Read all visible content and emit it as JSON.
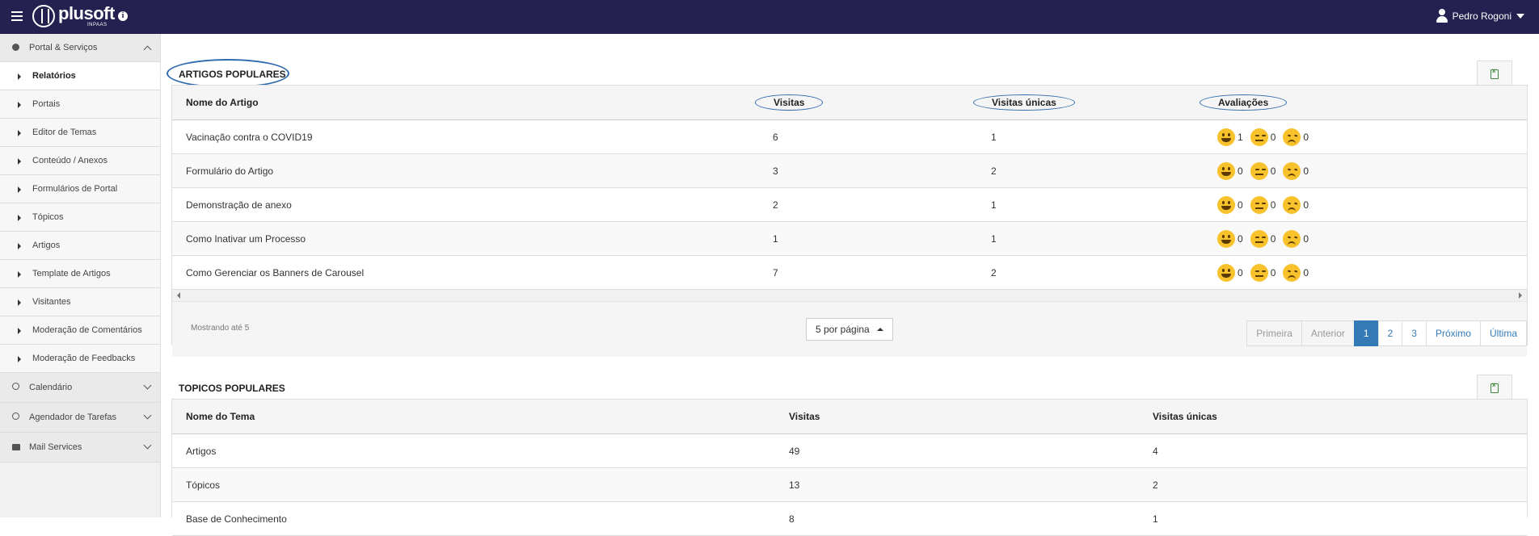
{
  "header": {
    "logo_text": "plusoft",
    "logo_sub": "INPAAS",
    "user_name": "Pedro Rogoni"
  },
  "sidebar": {
    "groups": [
      {
        "label": "Portal & Serviços",
        "icon": "globe-icon"
      },
      {
        "label": "Calendário",
        "icon": "clock-icon"
      },
      {
        "label": "Agendador de Tarefas",
        "icon": "clock-icon"
      },
      {
        "label": "Mail Services",
        "icon": "envelope-icon"
      }
    ],
    "items": [
      {
        "label": "Relatórios"
      },
      {
        "label": "Portais"
      },
      {
        "label": "Editor de Temas"
      },
      {
        "label": "Conteúdo / Anexos"
      },
      {
        "label": "Formulários de Portal"
      },
      {
        "label": "Tópicos"
      },
      {
        "label": "Artigos"
      },
      {
        "label": "Template de Artigos"
      },
      {
        "label": "Visitantes"
      },
      {
        "label": "Moderação de Comentários"
      },
      {
        "label": "Moderação de Feedbacks"
      }
    ]
  },
  "articles": {
    "title": "ARTIGOS POPULARES",
    "columns": [
      "Nome do Artigo",
      "Visitas",
      "Visitas únicas",
      "Avaliações"
    ],
    "rows": [
      {
        "name": "Vacinação contra o COVID19",
        "visits": "6",
        "unique": "1",
        "happy": "1",
        "neutral": "0",
        "sad": "0"
      },
      {
        "name": "Formulário do Artigo",
        "visits": "3",
        "unique": "2",
        "happy": "0",
        "neutral": "0",
        "sad": "0"
      },
      {
        "name": "Demonstração de anexo",
        "visits": "2",
        "unique": "1",
        "happy": "0",
        "neutral": "0",
        "sad": "0"
      },
      {
        "name": "Como Inativar um Processo",
        "visits": "1",
        "unique": "1",
        "happy": "0",
        "neutral": "0",
        "sad": "0"
      },
      {
        "name": "Como Gerenciar os Banners de Carousel",
        "visits": "7",
        "unique": "2",
        "happy": "0",
        "neutral": "0",
        "sad": "0"
      }
    ],
    "showing": "Mostrando até 5",
    "per_page": "5 por página",
    "pagination": {
      "first": "Primeira",
      "prev": "Anterior",
      "pages": [
        "1",
        "2",
        "3"
      ],
      "next": "Próximo",
      "last": "Última"
    }
  },
  "topics": {
    "title": "TOPICOS POPULARES",
    "columns": [
      "Nome do Tema",
      "Visitas",
      "Visitas únicas"
    ],
    "rows": [
      {
        "name": "Artigos",
        "visits": "49",
        "unique": "4"
      },
      {
        "name": "Tópicos",
        "visits": "13",
        "unique": "2"
      },
      {
        "name": "Base de Conhecimento",
        "visits": "8",
        "unique": "1"
      }
    ]
  },
  "colors": {
    "topbar": "#24204f",
    "accent": "#337ab7",
    "annotation_oval": "#2e6aad"
  }
}
